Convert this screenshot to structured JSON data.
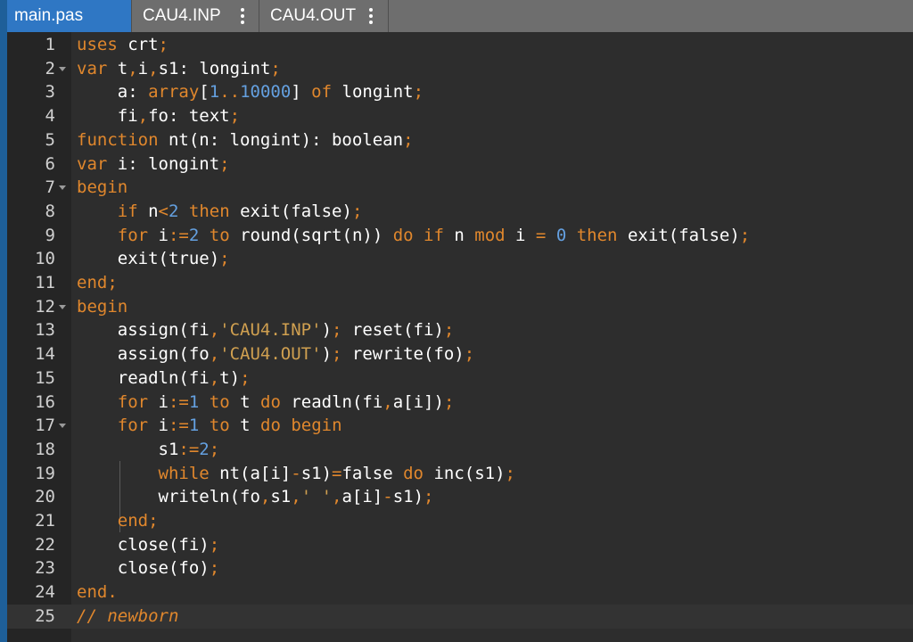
{
  "tabs": [
    {
      "label": "main.pas",
      "active": true
    },
    {
      "label": "CAU4.INP",
      "active": false
    },
    {
      "label": "CAU4.OUT",
      "active": false
    }
  ],
  "colors": {
    "keyword": "#e0872d",
    "number": "#64a0e0",
    "string": "#d0a050",
    "identifier": "#ffffff",
    "active_tab": "#2f77c4"
  },
  "icons": {
    "tab_menu": "kebab-menu-icon",
    "fold": "fold-arrow-icon"
  },
  "editor": {
    "current_line": 25,
    "lines": [
      {
        "num": "1",
        "text": "uses crt;"
      },
      {
        "num": "2",
        "text": "var t,i,s1: longint;"
      },
      {
        "num": "3",
        "text": "    a: array[1..10000] of longint;"
      },
      {
        "num": "4",
        "text": "    fi,fo: text;"
      },
      {
        "num": "5",
        "text": "function nt(n: longint): boolean;"
      },
      {
        "num": "6",
        "text": "var i: longint;"
      },
      {
        "num": "7",
        "text": "begin"
      },
      {
        "num": "8",
        "text": "    if n<2 then exit(false);"
      },
      {
        "num": "9",
        "text": "    for i:=2 to round(sqrt(n)) do if n mod i = 0 then exit(false);"
      },
      {
        "num": "10",
        "text": "    exit(true);"
      },
      {
        "num": "11",
        "text": "end;"
      },
      {
        "num": "12",
        "text": "begin"
      },
      {
        "num": "13",
        "text": "    assign(fi,'CAU4.INP'); reset(fi);"
      },
      {
        "num": "14",
        "text": "    assign(fo,'CAU4.OUT'); rewrite(fo);"
      },
      {
        "num": "15",
        "text": "    readln(fi,t);"
      },
      {
        "num": "16",
        "text": "    for i:=1 to t do readln(fi,a[i]);"
      },
      {
        "num": "17",
        "text": "    for i:=1 to t do begin"
      },
      {
        "num": "18",
        "text": "        s1:=2;"
      },
      {
        "num": "19",
        "text": "        while nt(a[i]-s1)=false do inc(s1);"
      },
      {
        "num": "20",
        "text": "        writeln(fo,s1,' ',a[i]-s1);"
      },
      {
        "num": "21",
        "text": "    end;"
      },
      {
        "num": "22",
        "text": "    close(fi);"
      },
      {
        "num": "23",
        "text": "    close(fo);"
      },
      {
        "num": "24",
        "text": "end."
      },
      {
        "num": "25",
        "text": "// newborn"
      }
    ]
  }
}
